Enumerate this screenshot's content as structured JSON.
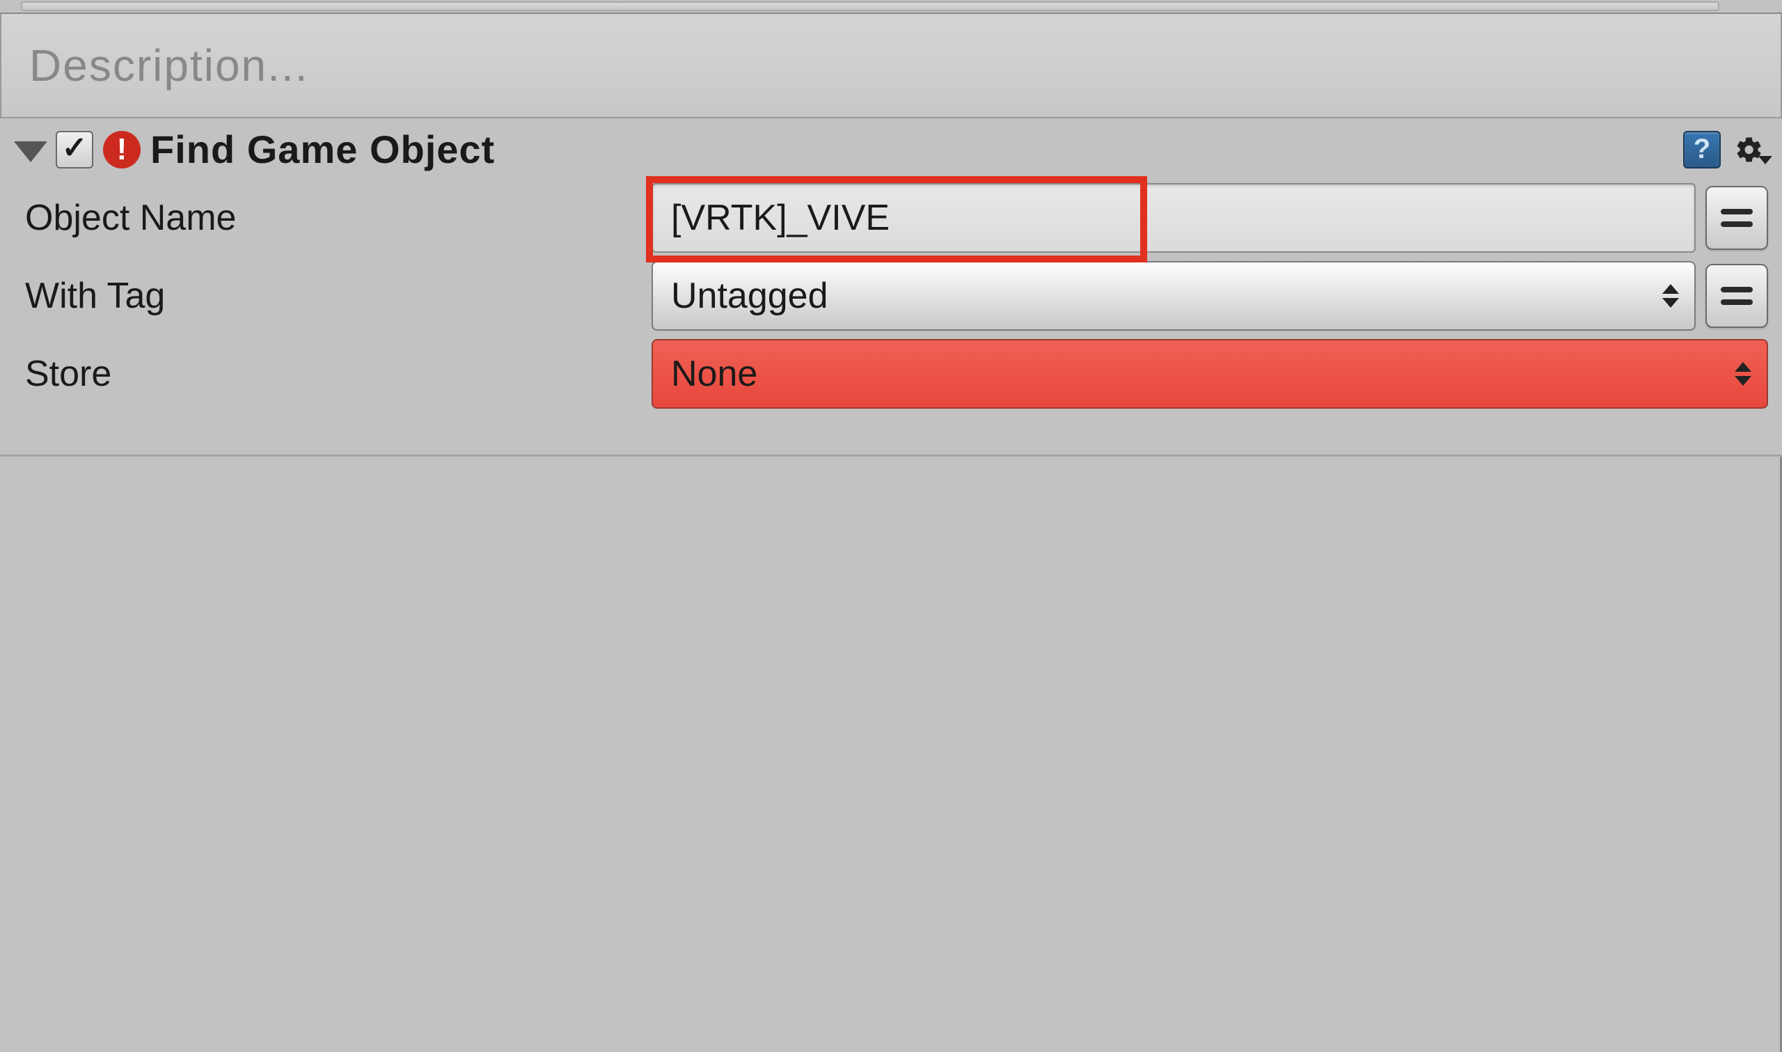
{
  "description": {
    "placeholder": "Description..."
  },
  "component": {
    "title": "Find Game Object",
    "enabled": true
  },
  "properties": {
    "object_name": {
      "label": "Object Name",
      "value": "[VRTK]_VIVE"
    },
    "with_tag": {
      "label": "With Tag",
      "value": "Untagged"
    },
    "store": {
      "label": "Store",
      "value": "None"
    }
  }
}
